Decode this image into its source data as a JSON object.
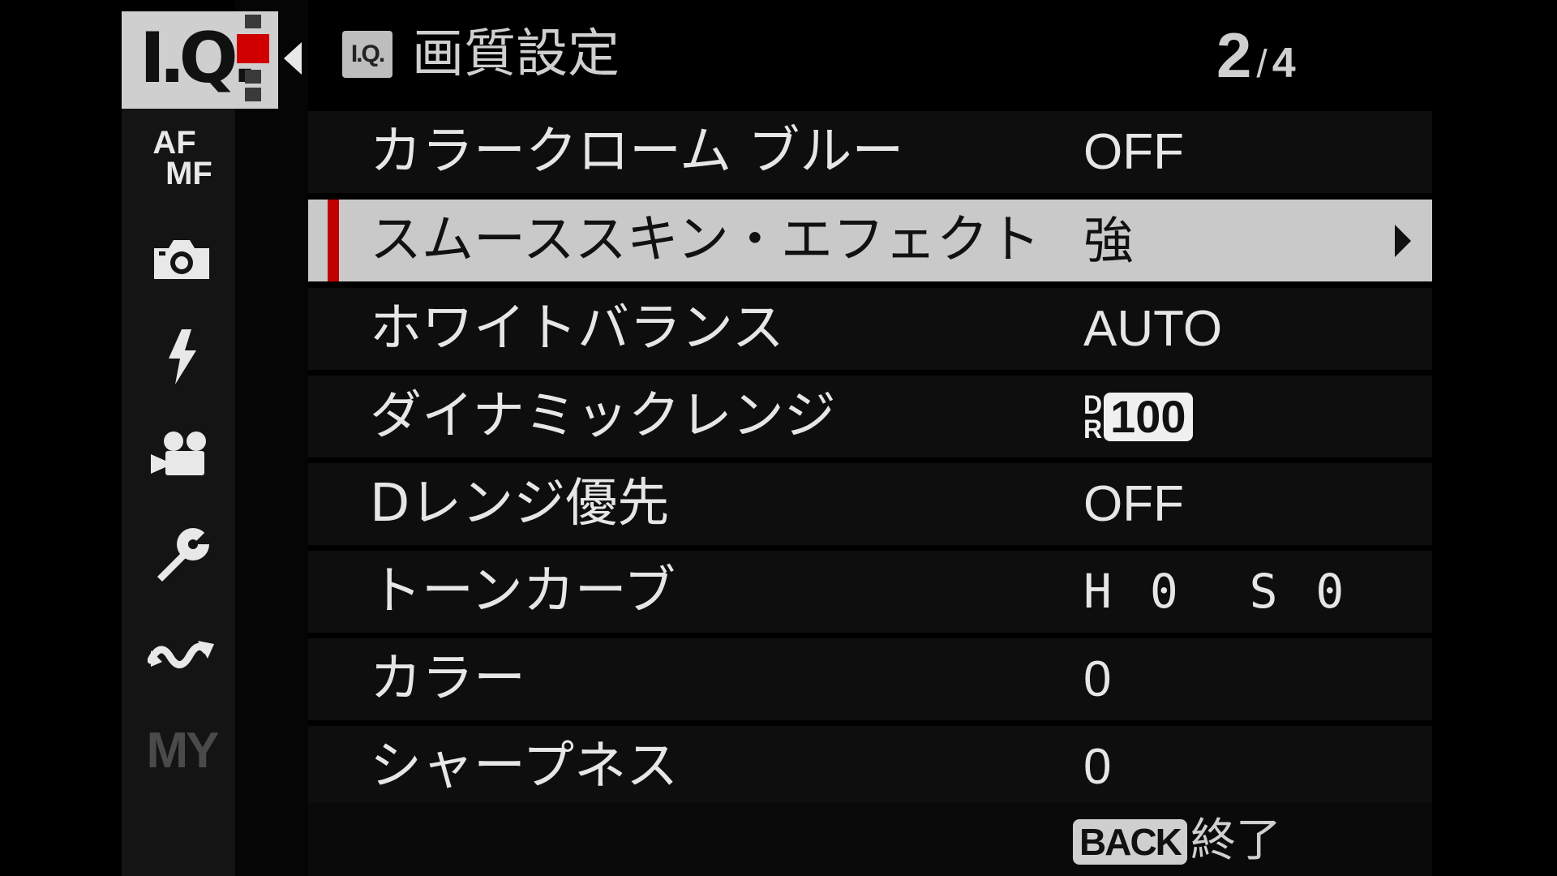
{
  "sidebar": {
    "active_tab_label": "I.Q.",
    "af_mf_top": "AF",
    "af_mf_bottom": "MF",
    "my_tab_label": "MY",
    "icons": [
      "camera-icon",
      "flash-icon",
      "movie-camera-icon",
      "wrench-icon",
      "connection-icon"
    ]
  },
  "header": {
    "badge": "I.Q.",
    "title": "画質設定",
    "page_current": "2",
    "page_separator": "/",
    "page_total": "4"
  },
  "menu": {
    "items": [
      {
        "label": "カラークローム ブルー",
        "value": "OFF"
      },
      {
        "label": "スムーススキン・エフェクト",
        "value": "強"
      },
      {
        "label": "ホワイトバランス",
        "value": "AUTO"
      },
      {
        "label": "ダイナミックレンジ",
        "value_prefix_top": "D",
        "value_prefix_bottom": "R",
        "value": "100"
      },
      {
        "label": "Dレンジ優先",
        "value": "OFF"
      },
      {
        "label": "トーンカーブ",
        "value": "H 0  S 0"
      },
      {
        "label": "カラー",
        "value": "0"
      },
      {
        "label": "シャープネス",
        "value": "0"
      }
    ],
    "selected_index": 1
  },
  "footer": {
    "back_button": "BACK",
    "back_label": "終了"
  },
  "colors": {
    "accent_red": "#d00000",
    "selected_row": "#c9c9c9",
    "row_bg": "#0e0e0e"
  }
}
